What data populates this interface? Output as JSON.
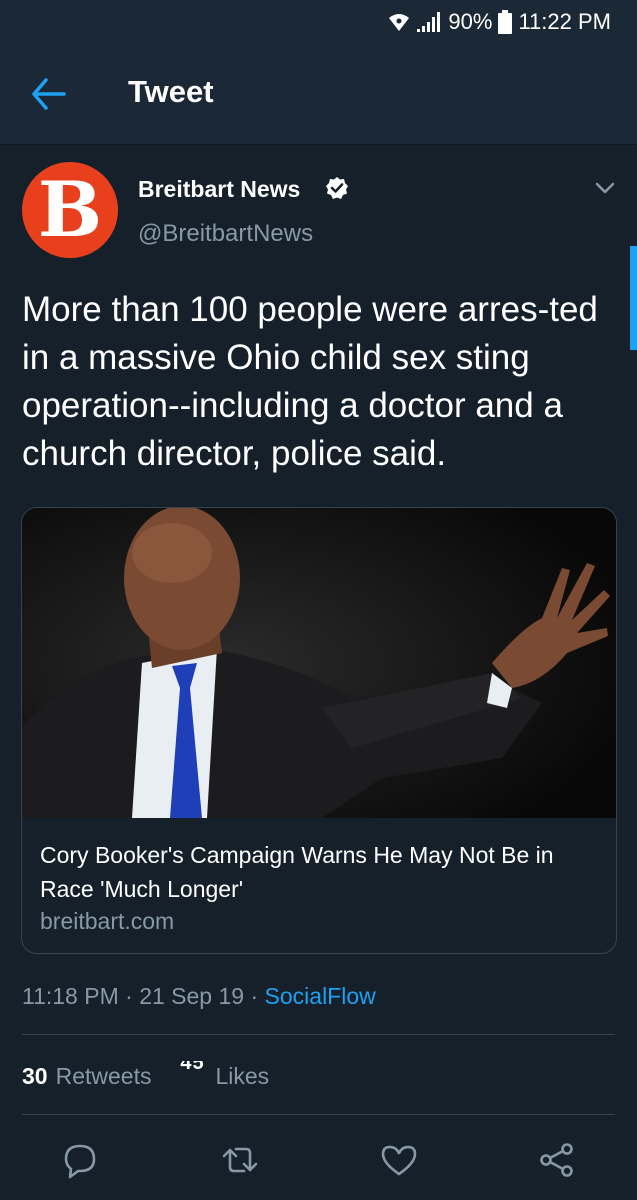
{
  "status_bar": {
    "battery": "90%",
    "time": "11:22 PM",
    "icons": [
      "wifi-icon",
      "signal-icon",
      "battery-icon"
    ]
  },
  "header": {
    "title": "Tweet",
    "back_icon": "back-arrow-icon"
  },
  "tweet": {
    "author_name": "Breitbart News",
    "handle": "@BreitbartNews",
    "avatar_letter": "B",
    "verified": true,
    "text": "More than 100 people were arres-ted in a massive Ohio child sex sting operation--including a doctor and a church director, police said.",
    "card": {
      "title": "Cory Booker's Campaign Warns He May Not Be in Race 'Much Longer'",
      "domain": "breitbart.com"
    },
    "time": "11:18 PM",
    "date": "21 Sep 19",
    "separator": "·",
    "source": "SocialFlow",
    "retweets_count": "30",
    "retweets_label": "Retweets",
    "likes_count": "45",
    "likes_label": "Likes"
  },
  "actions": [
    "reply-icon",
    "retweet-icon",
    "like-icon",
    "share-icon"
  ],
  "colors": {
    "background": "#15202b",
    "header_background": "#1b2836",
    "accent": "#1da1f2",
    "secondary_text": "#8899a6",
    "brand": "#e8401c",
    "border": "#38444d"
  }
}
